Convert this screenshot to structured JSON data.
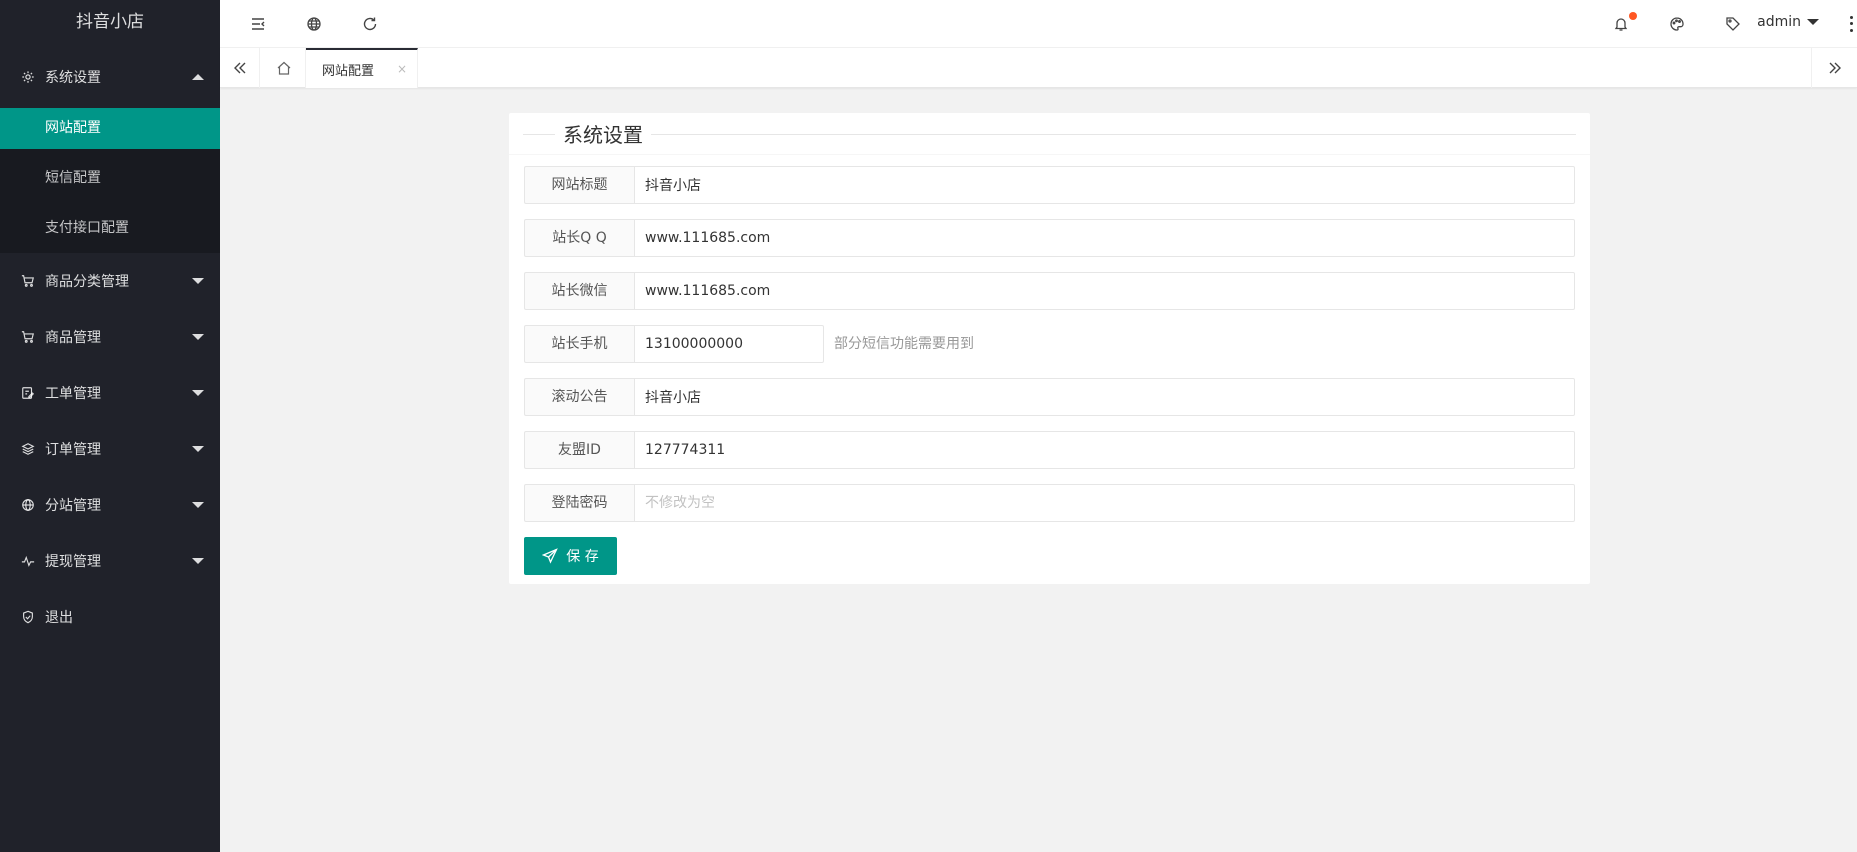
{
  "app": {
    "title": "抖音小店"
  },
  "sidebar": {
    "groups": [
      {
        "label": "系统设置",
        "icon": "gear-icon",
        "expanded": true,
        "children": [
          {
            "label": "网站配置",
            "active": true
          },
          {
            "label": "短信配置"
          },
          {
            "label": "支付接口配置"
          }
        ]
      },
      {
        "label": "商品分类管理",
        "icon": "cart-icon"
      },
      {
        "label": "商品管理",
        "icon": "cart-icon"
      },
      {
        "label": "工单管理",
        "icon": "edit-doc-icon"
      },
      {
        "label": "订单管理",
        "icon": "layers-icon"
      },
      {
        "label": "分站管理",
        "icon": "globe-icon"
      },
      {
        "label": "提现管理",
        "icon": "pulse-icon"
      },
      {
        "label": "退出",
        "icon": "shield-check-icon"
      }
    ]
  },
  "header": {
    "user": "admin",
    "icons": [
      "menu-fold-icon",
      "globe-icon",
      "refresh-icon",
      "bell-icon",
      "palette-icon",
      "tag-icon",
      "more-vertical-icon"
    ]
  },
  "tabs": {
    "active": "网站配置",
    "close": "×"
  },
  "form": {
    "title": "系统设置",
    "fields": [
      {
        "label": "网站标题",
        "value": "抖音小店",
        "placeholder": ""
      },
      {
        "label": "站长Q Q",
        "value": "www.111685.com",
        "placeholder": ""
      },
      {
        "label": "站长微信",
        "value": "www.111685.com",
        "placeholder": ""
      },
      {
        "label": "站长手机",
        "value": "13100000000",
        "placeholder": "",
        "aux": "部分短信功能需要用到"
      },
      {
        "label": "滚动公告",
        "value": "抖音小店",
        "placeholder": ""
      },
      {
        "label": "友盟ID",
        "value": "127774311",
        "placeholder": ""
      },
      {
        "label": "登陆密码",
        "value": "",
        "placeholder": "不修改为空"
      }
    ],
    "save_label": "保 存"
  },
  "colors": {
    "accent": "#009688",
    "sidebar_bg": "#20222a",
    "badge": "#ff5722"
  }
}
